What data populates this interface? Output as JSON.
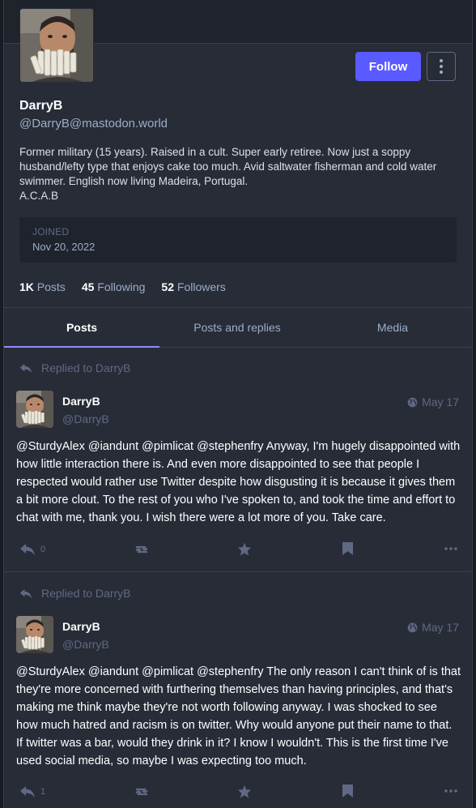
{
  "profile": {
    "display_name": "DarryB",
    "handle": "@DarryB@mastodon.world",
    "bio_lines": [
      "Former military (15 years). Raised in a cult. Super early retiree. Now just a soppy husband/lefty type that enjoys cake too much. Avid saltwater fisherman and cold water swimmer. English now living Madeira, Portugal.",
      "A.C.A.B"
    ],
    "follow_label": "Follow",
    "joined_label": "JOINED",
    "joined_date": "Nov 20, 2022",
    "counts": {
      "posts_value": "1K",
      "posts_label": "Posts",
      "following_value": "45",
      "following_label": "Following",
      "followers_value": "52",
      "followers_label": "Followers"
    }
  },
  "tabs": [
    {
      "label": "Posts",
      "active": true
    },
    {
      "label": "Posts and replies",
      "active": false
    },
    {
      "label": "Media",
      "active": false
    }
  ],
  "posts": [
    {
      "replied_to": "Replied to DarryB",
      "name": "DarryB",
      "handle": "@DarryB",
      "date": "May 17",
      "text": "@SturdyAlex @iandunt @pimlicat @stephenfry Anyway, I'm hugely disappointed with how little interaction there is. And even more disappointed to see that people I respected would rather use Twitter despite how disgusting it is because it gives them a bit more clout.  To the rest of you who I've spoken to, and took the time and effort to chat with me, thank you. I wish there were a lot more of you. Take care.",
      "reply_count": "0"
    },
    {
      "replied_to": "Replied to DarryB",
      "name": "DarryB",
      "handle": "@DarryB",
      "date": "May 17",
      "text": "@SturdyAlex @iandunt @pimlicat @stephenfry The only reason I can't think of is that they're more concerned with furthering themselves than having principles, and that's making me think maybe they're not worth following anyway. I was shocked to see how much hatred and racism is on twitter. Why would anyone put their name to that. If twitter was a bar, would they drink in it? I know I wouldn't. This is the first time I've used social media, so maybe I was expecting too much.",
      "reply_count": "1"
    }
  ],
  "colors": {
    "accent": "#595aff",
    "tab_underline": "#8c8dff",
    "background": "#282c37",
    "muted": "#606984"
  },
  "icons": [
    "more-vertical-icon",
    "reply-icon",
    "globe-icon",
    "boost-icon",
    "star-icon",
    "bookmark-icon",
    "ellipsis-icon"
  ]
}
